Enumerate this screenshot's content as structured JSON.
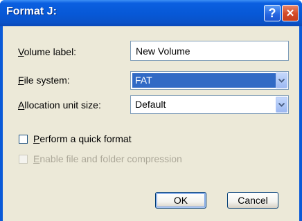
{
  "window": {
    "title": "Format J:",
    "help_glyph": "?",
    "close_glyph": "✕"
  },
  "form": {
    "volume_label": {
      "label": "Volume label:",
      "value": "New Volume"
    },
    "file_system": {
      "label": "File system:",
      "value": "FAT"
    },
    "allocation_unit_size": {
      "label": "Allocation unit size:",
      "value": "Default"
    }
  },
  "options": {
    "quick_format": {
      "label": "Perform a quick format",
      "checked": false
    },
    "compression": {
      "label": "Enable file and folder compression",
      "checked": false,
      "enabled": false
    }
  },
  "buttons": {
    "ok": "OK",
    "cancel": "Cancel"
  },
  "colors": {
    "titlebar": "#0758d6",
    "client": "#ece9d8",
    "selection": "#316ac5"
  }
}
